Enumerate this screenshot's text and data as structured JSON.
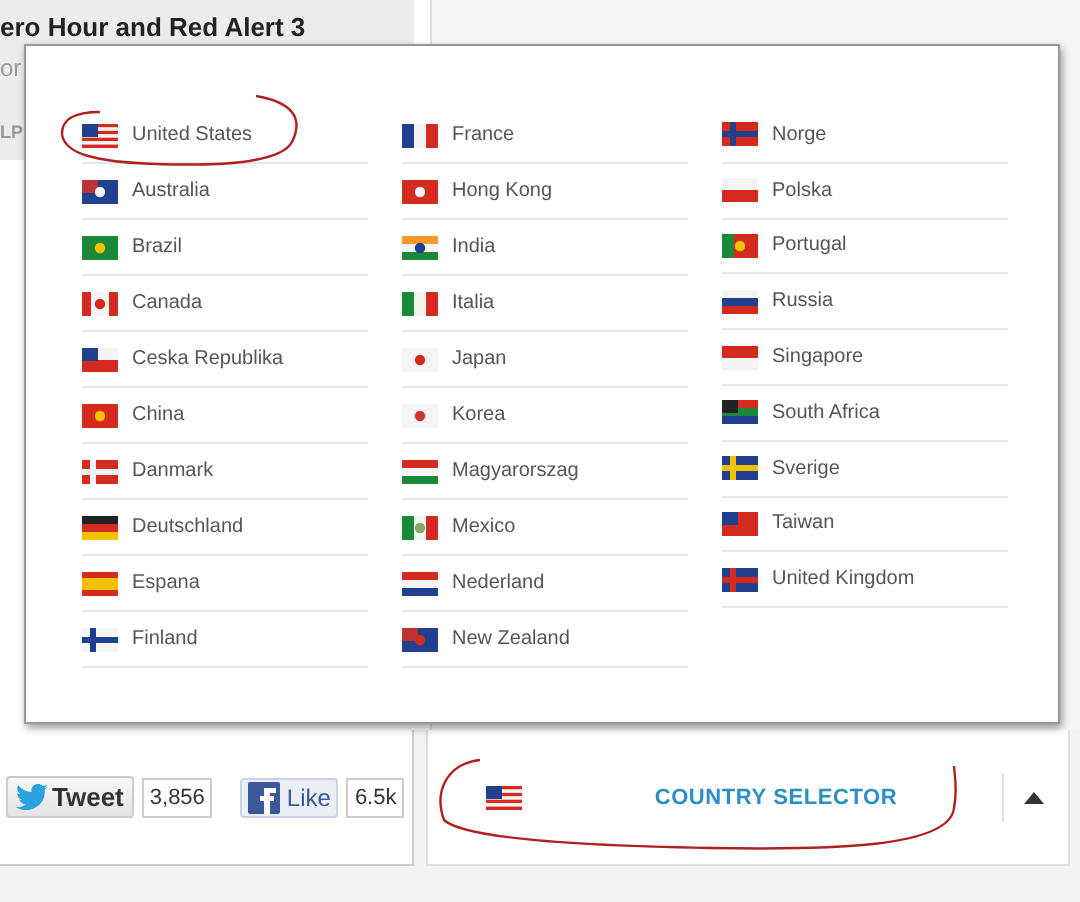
{
  "page": {
    "article_title": "ero Hour and Red Alert 3",
    "subtitle_fragment": "or",
    "label_fragment": "LP"
  },
  "country_menu": {
    "columns": [
      [
        {
          "name": "United States"
        },
        {
          "name": "Australia"
        },
        {
          "name": "Brazil"
        },
        {
          "name": "Canada"
        },
        {
          "name": "Ceska Republika"
        },
        {
          "name": "China"
        },
        {
          "name": "Danmark"
        },
        {
          "name": "Deutschland"
        },
        {
          "name": "Espana"
        },
        {
          "name": "Finland"
        }
      ],
      [
        {
          "name": "France"
        },
        {
          "name": "Hong Kong"
        },
        {
          "name": "India"
        },
        {
          "name": "Italia"
        },
        {
          "name": "Japan"
        },
        {
          "name": "Korea"
        },
        {
          "name": "Magyarorszag"
        },
        {
          "name": "Mexico"
        },
        {
          "name": "Nederland"
        },
        {
          "name": "New Zealand"
        }
      ],
      [
        {
          "name": "Norge"
        },
        {
          "name": "Polska"
        },
        {
          "name": "Portugal"
        },
        {
          "name": "Russia"
        },
        {
          "name": "Singapore"
        },
        {
          "name": "South Africa"
        },
        {
          "name": "Sverige"
        },
        {
          "name": "Taiwan"
        },
        {
          "name": "United Kingdom"
        }
      ]
    ]
  },
  "share_bar": {
    "tweet_label": "Tweet",
    "tweet_count": "3,856",
    "like_label": "Like",
    "like_count": "6.5k"
  },
  "country_selector": {
    "label": "COUNTRY SELECTOR",
    "expanded": true
  }
}
